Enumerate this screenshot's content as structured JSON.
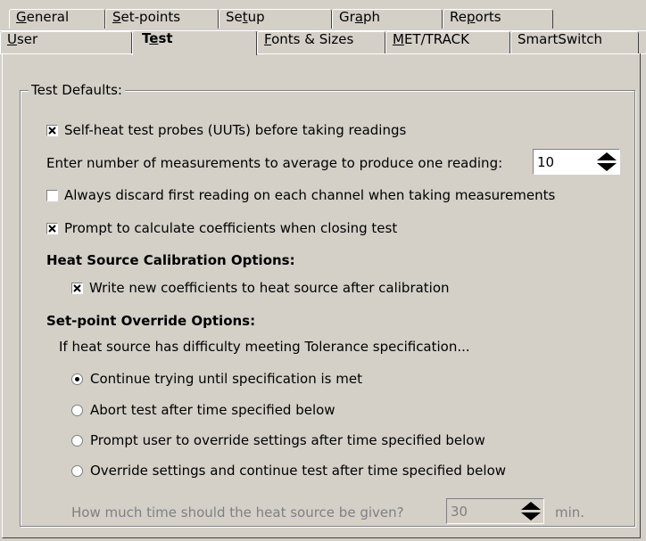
{
  "tabs_back": [
    {
      "label": "General",
      "ul": 0
    },
    {
      "label": "Set-points",
      "ul": 0
    },
    {
      "label": "Setup",
      "ul": 2
    },
    {
      "label": "Graph",
      "ul": 2
    },
    {
      "label": "Reports",
      "ul": 2
    }
  ],
  "tabs_front": [
    {
      "label": "User",
      "ul": 0
    },
    {
      "label": "Test",
      "ul": 1
    },
    {
      "label": "Fonts & Sizes",
      "ul": 0
    },
    {
      "label": "MET/TRACK",
      "ul": 0
    },
    {
      "label": "SmartSwitch",
      "ul": -1
    }
  ],
  "group_title": "Test Defaults:",
  "self_heat": {
    "label": "Self-heat test probes (UUTs) before taking readings",
    "checked": true
  },
  "average": {
    "label": "Enter number of measurements to average to produce one reading:",
    "value": "10"
  },
  "discard": {
    "label": "Always discard first reading on each channel when taking measurements",
    "checked": false
  },
  "prompt_coeff": {
    "label": "Prompt to calculate coefficients when closing test",
    "checked": true
  },
  "heat_header": "Heat Source Calibration Options:",
  "write_coeff": {
    "label": "Write new coefficients to heat source after calibration",
    "checked": true
  },
  "override_header": "Set-point Override Options:",
  "override_desc": "If heat source has difficulty meeting Tolerance specification...",
  "radios": [
    {
      "label": "Continue trying until specification is met",
      "selected": true
    },
    {
      "label": "Abort test after time specified below",
      "selected": false
    },
    {
      "label": "Prompt user to override settings after time specified below",
      "selected": false
    },
    {
      "label": "Override settings and continue test after time specified below",
      "selected": false
    }
  ],
  "time_question": "How much time should the heat source be given?",
  "time_value": "30",
  "time_unit": "min.",
  "colors": {
    "face": "#d4d0c8",
    "shadow": "#808080",
    "highlight": "#ffffff"
  }
}
